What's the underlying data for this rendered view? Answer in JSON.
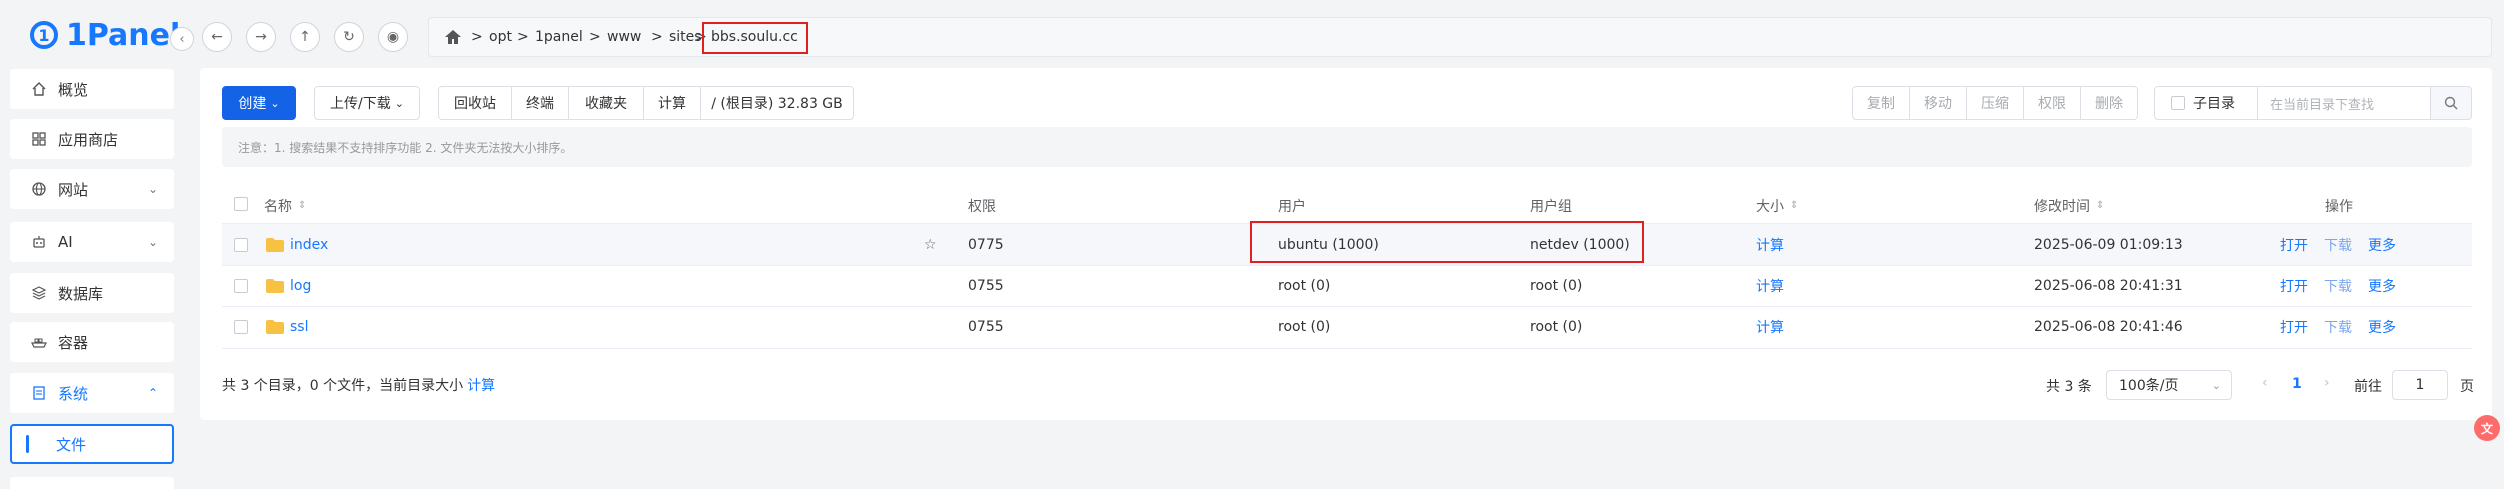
{
  "app": {
    "logo_text": "1Panel",
    "logo_mark": "1"
  },
  "sidebar": {
    "items": [
      {
        "label": "概览",
        "icon": "home-icon"
      },
      {
        "label": "应用商店",
        "icon": "grid-icon"
      },
      {
        "label": "网站",
        "icon": "globe-icon"
      },
      {
        "label": "AI",
        "icon": "robot-icon"
      },
      {
        "label": "数据库",
        "icon": "layers-icon"
      },
      {
        "label": "容器",
        "icon": "container-icon"
      },
      {
        "label": "系统",
        "icon": "system-icon"
      }
    ],
    "active_sub": "文件"
  },
  "path": {
    "crumbs": [
      "opt",
      "1panel",
      "www",
      "sites",
      "bbs.soulu.cc"
    ],
    "separator": ">"
  },
  "toolbar": {
    "create": "创建",
    "upload_download": "上传/下载",
    "recycle": "回收站",
    "terminal": "终端",
    "favorites": "收藏夹",
    "calculate": "计算",
    "disk": "/ (根目录) 32.83 GB",
    "copy": "复制",
    "move": "移动",
    "compress": "压缩",
    "permission": "权限",
    "delete": "删除",
    "subdir": "子目录",
    "search_placeholder": "在当前目录下查找"
  },
  "notice": "注意：1. 搜索结果不支持排序功能 2. 文件夹无法按大小排序。",
  "table": {
    "headers": {
      "name": "名称",
      "permission": "权限",
      "user": "用户",
      "group": "用户组",
      "size": "大小",
      "mtime": "修改时间",
      "ops": "操作"
    },
    "rows": [
      {
        "name": "index",
        "permission": "0775",
        "user": "ubuntu (1000)",
        "group": "netdev (1000)",
        "size": "计算",
        "mtime": "2025-06-09 01:09:13",
        "open": "打开",
        "download": "下载",
        "more": "更多"
      },
      {
        "name": "log",
        "permission": "0755",
        "user": "root (0)",
        "group": "root (0)",
        "size": "计算",
        "mtime": "2025-06-08 20:41:31",
        "open": "打开",
        "download": "下载",
        "more": "更多"
      },
      {
        "name": "ssl",
        "permission": "0755",
        "user": "root (0)",
        "group": "root (0)",
        "size": "计算",
        "mtime": "2025-06-08 20:41:46",
        "open": "打开",
        "download": "下载",
        "more": "更多"
      }
    ]
  },
  "footer": {
    "summary": "共 3 个目录，0 个文件，当前目录大小",
    "calculate": "计算",
    "total": "共 3 条",
    "page_size": "100条/页",
    "current_page": "1",
    "goto_label": "前往",
    "goto_value": "1",
    "page_unit": "页"
  },
  "colors": {
    "accent": "#1677ff",
    "primary_button": "#1463e6",
    "highlight_box": "#e02020"
  }
}
